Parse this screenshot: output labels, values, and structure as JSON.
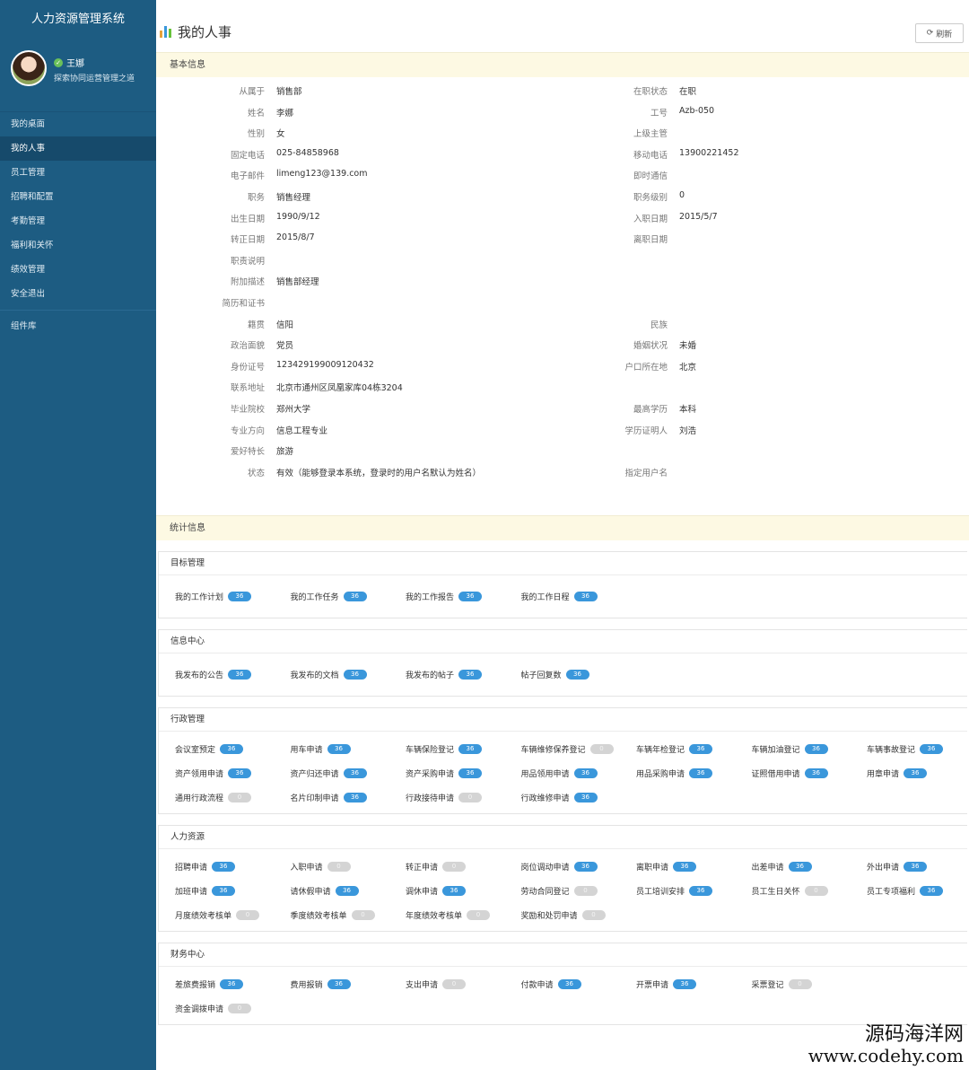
{
  "sidebar": {
    "title": "人力资源管理系统",
    "user": {
      "name": "王娜",
      "motto": "探索协同运营管理之道"
    },
    "menu": [
      "我的桌面",
      "我的人事",
      "员工管理",
      "招聘和配置",
      "考勤管理",
      "福利和关怀",
      "绩效管理",
      "安全退出"
    ],
    "extra": "组件库",
    "active_index": 1
  },
  "header": {
    "title": "我的人事",
    "refresh": "刷新"
  },
  "basic": {
    "title": "基本信息",
    "rows": [
      {
        "l1": "从属于",
        "v1": "销售部",
        "l2": "在职状态",
        "v2": "在职"
      },
      {
        "l1": "姓名",
        "v1": "李娜",
        "l2": "工号",
        "v2": "Azb-050"
      },
      {
        "l1": "性别",
        "v1": "女",
        "l2": "上级主管",
        "v2": ""
      },
      {
        "l1": "固定电话",
        "v1": "025-84858968",
        "l2": "移动电话",
        "v2": "13900221452"
      },
      {
        "l1": "电子邮件",
        "v1": "limeng123@139.com",
        "l2": "即时通信",
        "v2": ""
      },
      {
        "l1": "职务",
        "v1": "销售经理",
        "l2": "职务级别",
        "v2": "0"
      },
      {
        "l1": "出生日期",
        "v1": "1990/9/12",
        "l2": "入职日期",
        "v2": "2015/5/7"
      },
      {
        "l1": "转正日期",
        "v1": "2015/8/7",
        "l2": "离职日期",
        "v2": ""
      },
      {
        "l1": "职责说明",
        "v1": "",
        "l2": "",
        "v2": ""
      },
      {
        "l1": "附加描述",
        "v1": "销售部经理",
        "l2": "",
        "v2": ""
      },
      {
        "l1": "简历和证书",
        "v1": "",
        "l2": "",
        "v2": ""
      },
      {
        "l1": "籍贯",
        "v1": "信阳",
        "l2": "民族",
        "v2": ""
      },
      {
        "l1": "政治面貌",
        "v1": "党员",
        "l2": "婚姻状况",
        "v2": "未婚"
      },
      {
        "l1": "身份证号",
        "v1": "123429199009120432",
        "l2": "户口所在地",
        "v2": "北京"
      },
      {
        "l1": "联系地址",
        "v1": "北京市通州区凤凰家库04栋3204",
        "l2": "",
        "v2": ""
      },
      {
        "l1": "毕业院校",
        "v1": "郑州大学",
        "l2": "最高学历",
        "v2": "本科"
      },
      {
        "l1": "专业方向",
        "v1": "信息工程专业",
        "l2": "学历证明人",
        "v2": "刘浩"
      },
      {
        "l1": "爱好特长",
        "v1": "旅游",
        "l2": "",
        "v2": ""
      },
      {
        "l1": "状态",
        "v1": "有效（能够登录本系统，登录时的用户名默认为姓名）",
        "l2": "指定用户名",
        "v2": ""
      }
    ]
  },
  "stats": {
    "title": "统计信息",
    "groups": [
      {
        "title": "目标管理",
        "items": [
          {
            "label": "我的工作计划",
            "count": "36"
          },
          {
            "label": "我的工作任务",
            "count": "36"
          },
          {
            "label": "我的工作报告",
            "count": "36"
          },
          {
            "label": "我的工作日程",
            "count": "36"
          }
        ]
      },
      {
        "title": "信息中心",
        "items": [
          {
            "label": "我发布的公告",
            "count": "36"
          },
          {
            "label": "我发布的文档",
            "count": "36"
          },
          {
            "label": "我发布的帖子",
            "count": "36"
          },
          {
            "label": "帖子回复数",
            "count": "36"
          }
        ]
      },
      {
        "title": "行政管理",
        "items": [
          {
            "label": "会议室预定",
            "count": "36"
          },
          {
            "label": "用车申请",
            "count": "36"
          },
          {
            "label": "车辆保险登记",
            "count": "36"
          },
          {
            "label": "车辆维修保养登记",
            "count": "0"
          },
          {
            "label": "车辆年检登记",
            "count": "36"
          },
          {
            "label": "车辆加油登记",
            "count": "36"
          },
          {
            "label": "车辆事故登记",
            "count": "36"
          },
          {
            "label": "资产领用申请",
            "count": "36"
          },
          {
            "label": "资产归还申请",
            "count": "36"
          },
          {
            "label": "资产采购申请",
            "count": "36"
          },
          {
            "label": "用品领用申请",
            "count": "36"
          },
          {
            "label": "用品采购申请",
            "count": "36"
          },
          {
            "label": "证照借用申请",
            "count": "36"
          },
          {
            "label": "用章申请",
            "count": "36"
          },
          {
            "label": "通用行政流程",
            "count": "0"
          },
          {
            "label": "名片印制申请",
            "count": "36"
          },
          {
            "label": "行政接待申请",
            "count": "0"
          },
          {
            "label": "行政维修申请",
            "count": "36"
          }
        ]
      },
      {
        "title": "人力资源",
        "items": [
          {
            "label": "招聘申请",
            "count": "36"
          },
          {
            "label": "入职申请",
            "count": "0"
          },
          {
            "label": "转正申请",
            "count": "0"
          },
          {
            "label": "岗位调动申请",
            "count": "36"
          },
          {
            "label": "离职申请",
            "count": "36"
          },
          {
            "label": "出差申请",
            "count": "36"
          },
          {
            "label": "外出申请",
            "count": "36"
          },
          {
            "label": "加班申请",
            "count": "36"
          },
          {
            "label": "请休假申请",
            "count": "36"
          },
          {
            "label": "调休申请",
            "count": "36"
          },
          {
            "label": "劳动合同登记",
            "count": "0"
          },
          {
            "label": "员工培训安排",
            "count": "36"
          },
          {
            "label": "员工生日关怀",
            "count": "0"
          },
          {
            "label": "员工专项福利",
            "count": "36"
          },
          {
            "label": "月度绩效考核单",
            "count": "0"
          },
          {
            "label": "季度绩效考核单",
            "count": "0"
          },
          {
            "label": "年度绩效考核单",
            "count": "0"
          },
          {
            "label": "奖励和处罚申请",
            "count": "0"
          }
        ]
      },
      {
        "title": "财务中心",
        "items": [
          {
            "label": "差旅费报销",
            "count": "36"
          },
          {
            "label": "费用报销",
            "count": "36"
          },
          {
            "label": "支出申请",
            "count": "0"
          },
          {
            "label": "付款申请",
            "count": "36"
          },
          {
            "label": "开票申请",
            "count": "36"
          },
          {
            "label": "采票登记",
            "count": "0"
          },
          {
            "label": "",
            "count": ""
          },
          {
            "label": "资金调拨申请",
            "count": "0"
          }
        ]
      }
    ]
  },
  "watermark": {
    "line1": "源码海洋网",
    "line2": "www.codehy.com"
  },
  "colors": {
    "sidebar": "#1d5c82",
    "badge": "#3a97db",
    "section": "#fdf9e3"
  }
}
